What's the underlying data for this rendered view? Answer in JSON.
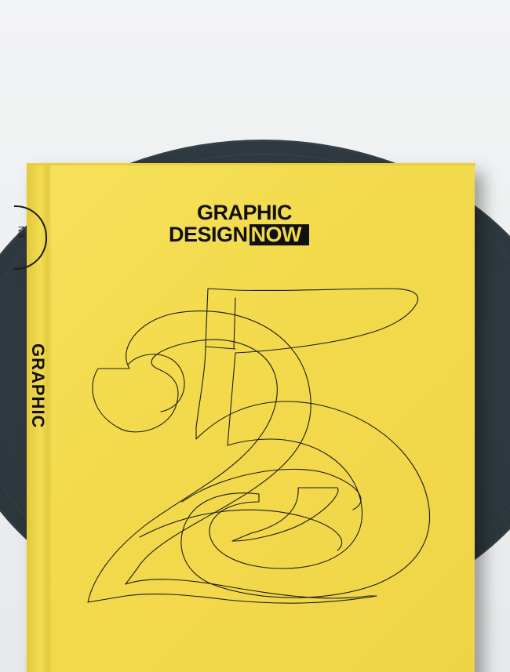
{
  "cover": {
    "title_line1": "GRAPHIC",
    "title_line2_left": "DESIGN",
    "title_line2_right": "NOW",
    "large_numeral": "25"
  },
  "spine": {
    "title": "GRAPHIC",
    "badge_text": "EN"
  },
  "colors": {
    "cover_yellow": "#f3da4c",
    "plate": "#2f3a40",
    "background": "#eef0f1",
    "ink": "#111111"
  }
}
